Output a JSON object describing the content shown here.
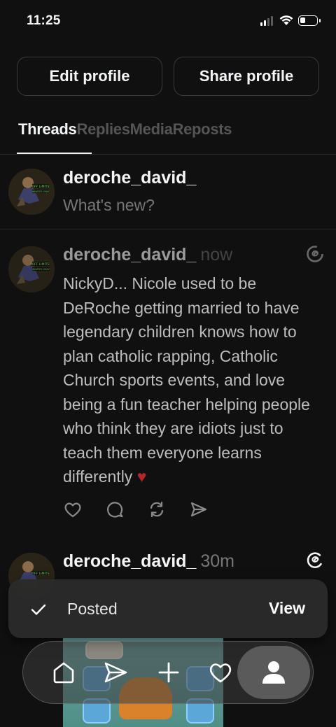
{
  "status_bar": {
    "time": "11:25"
  },
  "profile_actions": {
    "edit_label": "Edit profile",
    "share_label": "Share profile"
  },
  "tabs": [
    {
      "label": "Threads",
      "active": true
    },
    {
      "label": "Replies",
      "active": false
    },
    {
      "label": "Media",
      "active": false
    },
    {
      "label": "Reposts",
      "active": false
    }
  ],
  "composer": {
    "username": "deroche_david_",
    "placeholder": "What's new?"
  },
  "posts": [
    {
      "username": "deroche_david_",
      "time": "now",
      "text": "NickyD... Nicole used to be DeRoche getting married to have legendary children knows how to plan catholic rapping, Catholic Church sports events, and love being a fun teacher helping people who think they are idiots just to teach them everyone learns differently",
      "emoji": "♥",
      "status": "posting"
    },
    {
      "username": "deroche_david_",
      "time": "30m"
    }
  ],
  "toast": {
    "message": "Posted",
    "action": "View"
  },
  "nav": {
    "items": [
      "home-icon",
      "send-icon",
      "plus-icon",
      "heart-icon",
      "profile-icon"
    ],
    "active": "profile-icon"
  },
  "colors": {
    "background": "#101010",
    "text": "#f3f5f7",
    "muted": "#777777",
    "heart": "#b3262a"
  }
}
